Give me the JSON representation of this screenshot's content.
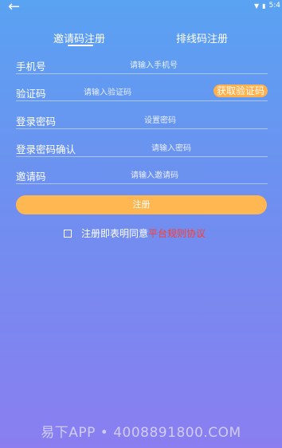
{
  "status_bar": {
    "time": "5:4",
    "back_icon": "arrow-left-icon"
  },
  "tabs": [
    {
      "label": "邀请码注册",
      "active": true
    },
    {
      "label": "排线码注册",
      "active": false
    }
  ],
  "form": {
    "phone": {
      "label": "手机号",
      "placeholder": "请输入手机号"
    },
    "code": {
      "label": "验证码",
      "placeholder": "请输入验证码",
      "button": "获取验证码"
    },
    "password": {
      "label": "登录密码",
      "placeholder": "设置密码"
    },
    "confirm": {
      "label": "登录密码确认",
      "placeholder": "请输入密码"
    },
    "invite": {
      "label": "邀请码",
      "placeholder": "请输入邀请码"
    }
  },
  "submit_label": "注册",
  "agreement": {
    "text": "注册即表明同意",
    "link": "平台规则协议"
  },
  "watermark": "易下APP • 4008891800.COM",
  "colors": {
    "accent_button": "#ffb751",
    "link": "#ff3b30",
    "bg_top": "#5aa2f2",
    "bg_bottom": "#8a7ef0"
  }
}
